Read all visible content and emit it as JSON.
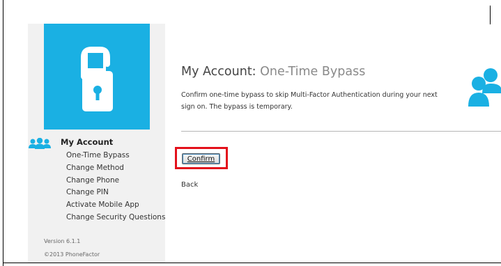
{
  "sidebar": {
    "account_title": "My Account",
    "menu": [
      {
        "label": "One-Time Bypass"
      },
      {
        "label": "Change Method"
      },
      {
        "label": "Change Phone"
      },
      {
        "label": "Change PIN"
      },
      {
        "label": "Activate Mobile App"
      },
      {
        "label": "Change Security Questions"
      }
    ],
    "version": "Version 6.1.1",
    "copyright": "©2013 PhoneFactor"
  },
  "main": {
    "title": "My Account:",
    "subtitle": "One-Time Bypass",
    "description": "Confirm one-time bypass to skip Multi-Factor Authentication during your next sign on. The bypass is temporary.",
    "confirm_label": "Confirm",
    "back_label": "Back"
  },
  "icons": {
    "logo": "phone-padlock-icon",
    "account": "users-icon",
    "header_account": "users-icon"
  },
  "colors": {
    "brand_blue": "#1ab0e3",
    "highlight_red": "#e3111b",
    "subtitle_gray": "#8a8a8a"
  }
}
